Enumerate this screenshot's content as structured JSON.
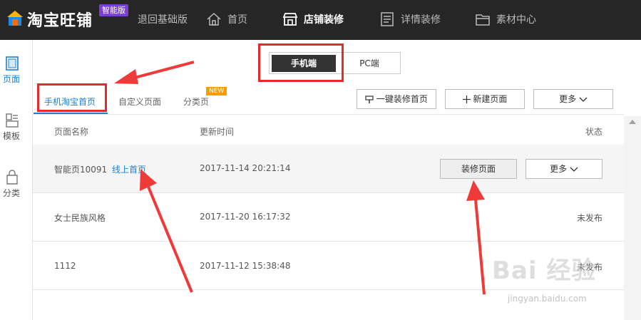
{
  "header": {
    "brand": "淘宝旺铺",
    "badge": "智能版",
    "nav": [
      {
        "label": "退回基础版"
      },
      {
        "label": "首页"
      },
      {
        "label": "店铺装修"
      },
      {
        "label": "详情装修"
      },
      {
        "label": "素材中心"
      }
    ]
  },
  "sidebar": {
    "items": [
      {
        "label": "页面"
      },
      {
        "label": "模板"
      },
      {
        "label": "分类"
      }
    ]
  },
  "device_toggle": {
    "mobile": "手机端",
    "pc": "PC端"
  },
  "tabs": [
    {
      "label": "手机淘宝首页"
    },
    {
      "label": "自定义页面"
    },
    {
      "label": "分类页"
    }
  ],
  "new_badge": "NEW",
  "actions": {
    "one_click": "一键装修首页",
    "new_page": "新建页面",
    "more": "更多"
  },
  "table": {
    "headers": [
      "页面名称",
      "更新时间",
      "状态"
    ],
    "rows": [
      {
        "name": "智能页10091",
        "tag": "线上首页",
        "time": "2017-11-14 20:21:14",
        "action": "装修页面",
        "more": "更多",
        "status": ""
      },
      {
        "name": "女士民族风格",
        "tag": "",
        "time": "2017-11-20 16:17:32",
        "status": "未发布"
      },
      {
        "name": "1112",
        "tag": "",
        "time": "2017-11-12 15:38:48",
        "status": "未发布"
      }
    ]
  },
  "watermark": {
    "main": "Bai 经验",
    "sub": "jingyan.baidu.com"
  },
  "colors": {
    "topbar": "#262626",
    "accent": "#1c7fd6",
    "annotation": "#e52a2a",
    "badge": "#7b3fd6",
    "new_badge": "#ff9a00"
  }
}
